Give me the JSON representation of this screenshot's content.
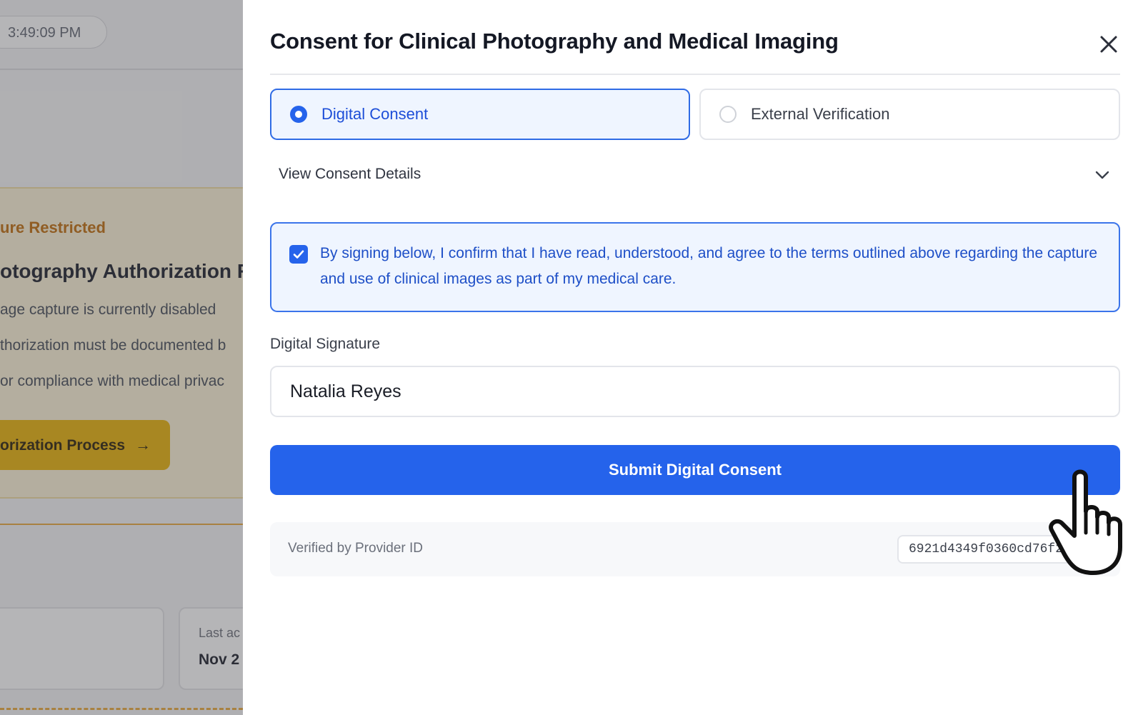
{
  "background_page": {
    "time": "3:49:09 PM",
    "warning_label": "ure Restricted",
    "heading": "otography Authorization R",
    "lines": [
      "age capture is currently disabled",
      "thorization must be documented b",
      "or compliance with medical privac"
    ],
    "cta_label": "orization Process",
    "card_label": "Last ac",
    "card_value": "Nov 2"
  },
  "modal": {
    "title": "Consent for Clinical Photography and Medical Imaging",
    "options": [
      {
        "label": "Digital Consent",
        "selected": true
      },
      {
        "label": "External Verification",
        "selected": false
      }
    ],
    "details_label": "View Consent Details",
    "agreement": {
      "checked": true,
      "text": "By signing below, I confirm that I have read, understood, and agree to the terms outlined above regarding the capture and use of clinical images as part of my medical care."
    },
    "signature": {
      "label": "Digital Signature",
      "value": "Natalia Reyes"
    },
    "submit_label": "Submit Digital Consent",
    "verification": {
      "label": "Verified by Provider ID",
      "provider_id": "6921d4349f0360cd76f253cc"
    }
  },
  "colors": {
    "primary": "#2563eb",
    "primary_light_bg": "#eff5ff",
    "warning": "#c26d0a",
    "warning_button": "#eab308"
  },
  "icons": [
    "close-icon",
    "chevron-down-icon",
    "check-icon",
    "arrow-right-icon",
    "hand-pointer-icon"
  ]
}
